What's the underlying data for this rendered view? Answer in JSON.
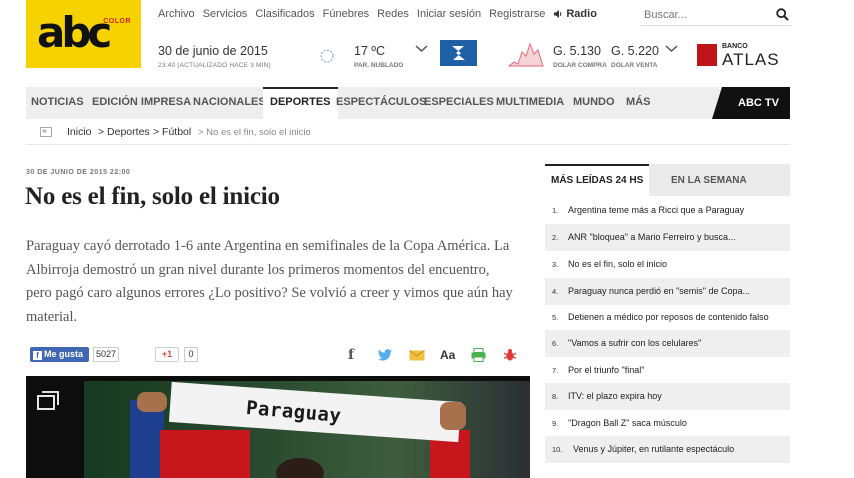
{
  "logo": {
    "color_text": "COLOR",
    "brand_text": "abc"
  },
  "topnav": {
    "items": [
      "Archivo",
      "Servicios",
      "Clasificados",
      "Fúnebres",
      "Redes",
      "Iniciar sesión",
      "Registrarse"
    ],
    "radio_label": "Radio"
  },
  "search": {
    "placeholder": "Buscar..."
  },
  "header": {
    "date": "30 de junio de 2015",
    "updated": "23:40 (ACTUALIZADO HACE 3 MIN)",
    "temperature": "17 ºC",
    "condition": "PAR. NUBLADO",
    "dolar_compra_value": "G. 5.130",
    "dolar_compra_label": "DOLAR COMPRA",
    "dolar_venta_value": "G. 5.220",
    "dolar_venta_label": "DOLAR VENTA",
    "bank_small": "BANCO",
    "bank_name": "ATLAS"
  },
  "mainnav": {
    "items": [
      "NOTICIAS",
      "EDICIÓN IMPRESA",
      "NACIONALES",
      "DEPORTES",
      "ESPECTÁCULOS",
      "ESPECIALES",
      "MULTIMEDIA",
      "MUNDO",
      "MÁS"
    ],
    "active": "DEPORTES",
    "tv_label": "ABC TV"
  },
  "breadcrumb": {
    "home": "Inicio",
    "section": "> Deportes",
    "subsection": "> Fútbol",
    "current": "> No es el fin, solo el inicio"
  },
  "article": {
    "date": "30 DE JUNIO DE 2015 22:00",
    "headline": "No es el fin, solo el inicio",
    "lead_lines": [
      "Paraguay cayó derrotado 1-6 ante Argentina en semifinales de la Copa América. La",
      "Albirroja demostró un gran nivel durante los primeros momentos del encuentro,",
      "pero pagó caro algunos errores ¿Lo positivo? Se volvió a creer y vimos que aún hay",
      "material."
    ],
    "photo_scarf_text": "Paraguay"
  },
  "share": {
    "like_label": "Me gusta",
    "like_count": "5027",
    "gplus_label": "+1",
    "gplus_count": "0",
    "font_label": "Aa"
  },
  "sidebar": {
    "tabs": [
      "MÁS LEÍDAS 24 HS",
      "EN LA SEMANA"
    ],
    "ranking": [
      {
        "num": "1.",
        "title": "Argentina teme más a Ricci que a Paraguay"
      },
      {
        "num": "2.",
        "title": "ANR \"bloquea\" a Mario Ferreiro y busca..."
      },
      {
        "num": "3.",
        "title": "No es el fin, solo el inicio"
      },
      {
        "num": "4.",
        "title": "Paraguay nunca perdió en \"semis\" de Copa..."
      },
      {
        "num": "5.",
        "title": "Detienen a médico por reposos de contenido falso"
      },
      {
        "num": "6.",
        "title": "\"Vamos a sufrir con los celulares\""
      },
      {
        "num": "7.",
        "title": "Por el triunfo \"final\""
      },
      {
        "num": "8.",
        "title": "ITV: el plazo expira hoy"
      },
      {
        "num": "9.",
        "title": "\"Dragon Ball Z\" saca músculo"
      },
      {
        "num": "10.",
        "title": "Venus y Júpiter, en rutilante espectáculo"
      }
    ]
  },
  "colors": {
    "logo_yellow": "#f6d200",
    "logo_red": "#e2231a",
    "facebook_blue": "#4267b2",
    "tv_black": "#111111",
    "nav_gray": "#eeeeee"
  }
}
